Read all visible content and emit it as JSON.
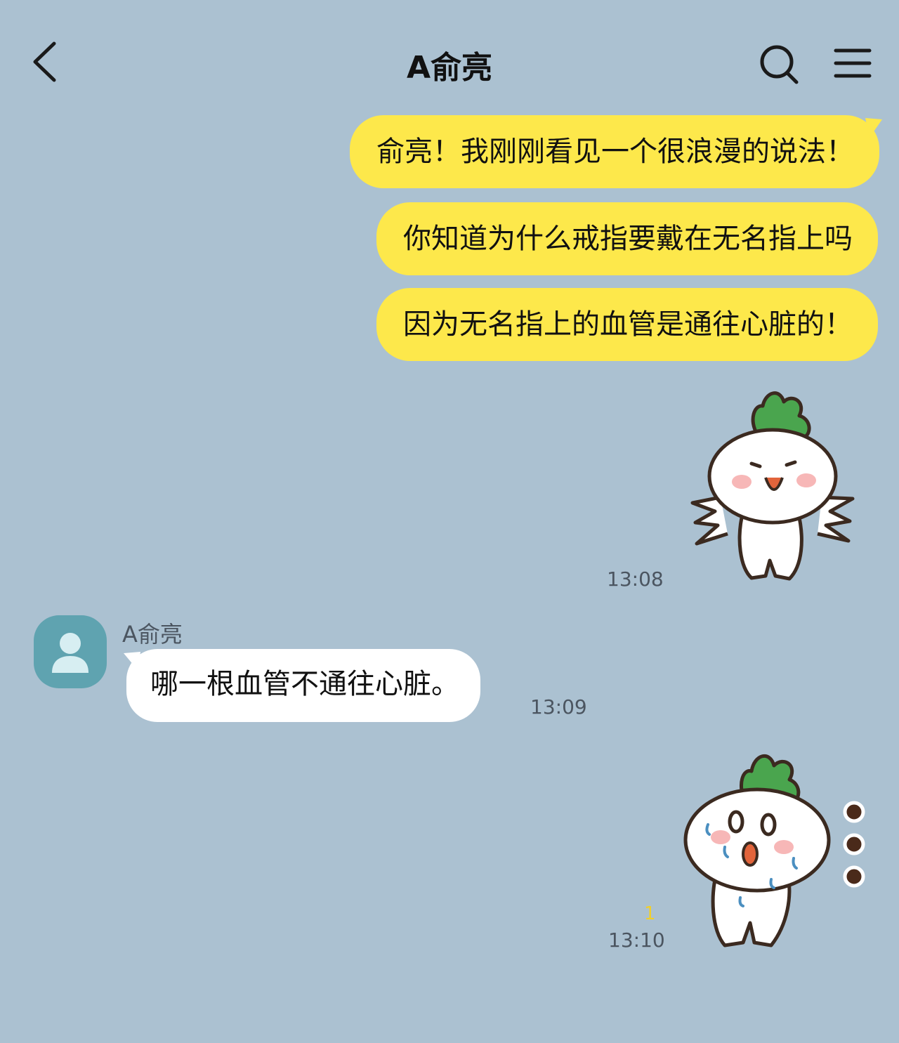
{
  "header": {
    "title": "A俞亮",
    "back_icon": "chevron-left-icon",
    "search_icon": "search-icon",
    "menu_icon": "hamburger-menu-icon"
  },
  "messages": [
    {
      "sender": "me",
      "text": "俞亮！我刚刚看见一个很浪漫的说法！"
    },
    {
      "sender": "me",
      "text": "你知道为什么戒指要戴在无名指上吗"
    },
    {
      "sender": "me",
      "text": "因为无名指上的血管是通往心脏的！"
    },
    {
      "sender": "me",
      "type": "sticker",
      "sticker": "radish-flapping-arms-sticker",
      "time": "13:08"
    },
    {
      "sender": "other",
      "name": "A俞亮",
      "text": "哪一根血管不通往心脏。",
      "time": "13:09"
    },
    {
      "sender": "me",
      "type": "sticker",
      "sticker": "radish-shocked-crying-sticker",
      "unread": "1",
      "time": "13:10"
    }
  ],
  "colors": {
    "background": "#abc1d1",
    "my_bubble": "#fde84b",
    "their_bubble": "#ffffff",
    "avatar": "#5fa3b0",
    "unread": "#f1cf2a"
  }
}
